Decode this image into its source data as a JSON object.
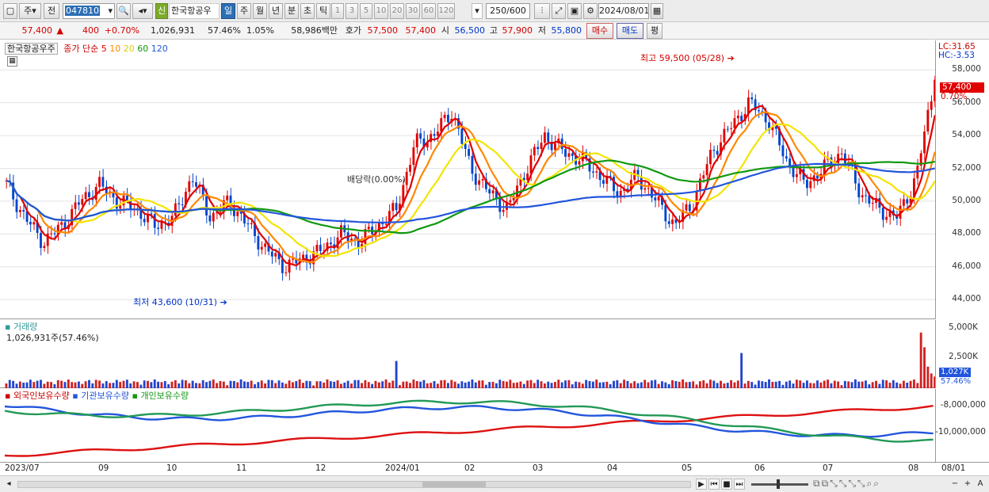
{
  "toolbar": {
    "period": "주",
    "prev": "전",
    "code": "047810",
    "credit_badge": "신",
    "stock_name": "한국항공우",
    "intervals": [
      "일",
      "주",
      "월",
      "년",
      "분",
      "초",
      "틱"
    ],
    "active_interval": "일",
    "minute_units": [
      "1",
      "3",
      "5",
      "10",
      "20",
      "30",
      "60",
      "120"
    ],
    "count": "250",
    "total": "/600",
    "date": "2024/08/01"
  },
  "quote": {
    "price": "57,400",
    "change": "400",
    "change_pct": "+0.70%",
    "volume": "1,026,931",
    "vol_ratio": "57.46%",
    "turnover": "1.05%",
    "amount": "58,986백만",
    "hoga_label": "호가",
    "ask": "57,500",
    "bid": "57,400",
    "open_label": "시",
    "open": "56,500",
    "high_label": "고",
    "high": "57,900",
    "low_label": "저",
    "low": "55,800",
    "buy_btn": "매수",
    "sell_btn": "매도",
    "eval_btn": "평"
  },
  "price_panel": {
    "title": "한국항공우주",
    "ma_label": "종가 단순",
    "ma_periods": [
      "5",
      "10",
      "20",
      "60",
      "120"
    ],
    "lc": "LC:31.65",
    "hc": "HC:-3.53",
    "y_ticks": [
      "58,000",
      "56,000",
      "54,000",
      "52,000",
      "50,000",
      "48,000",
      "46,000",
      "44,000"
    ],
    "cur_price_tag": "57,400",
    "cur_pct_tag": "0.70%",
    "high_annotation": "최고 59,500 (05/28)",
    "low_annotation": "최저 43,600 (10/31)",
    "dividend_annotation": "배당락(0.00%)"
  },
  "volume_panel": {
    "title": "거래량",
    "value": "1,026,931주(57.46%)",
    "y_ticks": [
      "5,000K",
      "2,500K"
    ],
    "tag_value": "1,027K",
    "tag_pct": "57.46%"
  },
  "holding_panel": {
    "titles": [
      "외국인보유수량",
      "기관보유수량",
      "개인보유수량"
    ],
    "y_ticks": [
      "-8,000,000",
      "-10,000,000"
    ]
  },
  "x_axis": {
    "labels": [
      "2023/07",
      "09",
      "10",
      "11",
      "12",
      "2024/01",
      "02",
      "03",
      "04",
      "05",
      "06",
      "07",
      "08",
      "08/01"
    ]
  },
  "chart_data": {
    "type": "candlestick",
    "ylim": [
      42800,
      59800
    ],
    "high": {
      "value": 59500,
      "date": "05/28"
    },
    "low": {
      "value": 43600,
      "date": "10/31"
    },
    "closes_weekly_approx": [
      51000,
      49000,
      47500,
      48500,
      50000,
      51000,
      50000,
      49500,
      48500,
      49000,
      51500,
      49000,
      50000,
      48500,
      47000,
      46000,
      46500,
      47000,
      48000,
      47500,
      48500,
      49500,
      53500,
      54000,
      55500,
      52000,
      50500,
      49500,
      52000,
      54000,
      53000,
      52500,
      51500,
      50500,
      51500,
      50000,
      48500,
      50000,
      53000,
      54500,
      56000,
      55000,
      52500,
      51000,
      52000,
      53000,
      50500,
      49500,
      49000,
      51500,
      57400
    ],
    "volume_last": 1026931,
    "volume_ylim_k": [
      0,
      6000
    ],
    "holding_ylim_m": [
      -11000000,
      -7000000
    ],
    "colors": {
      "up": "#e00000",
      "down": "#0044cc",
      "ma5": "#e00000",
      "ma10": "#ff8800",
      "ma20": "#f4e400",
      "ma60": "#119911",
      "ma120": "#2255dd"
    }
  }
}
